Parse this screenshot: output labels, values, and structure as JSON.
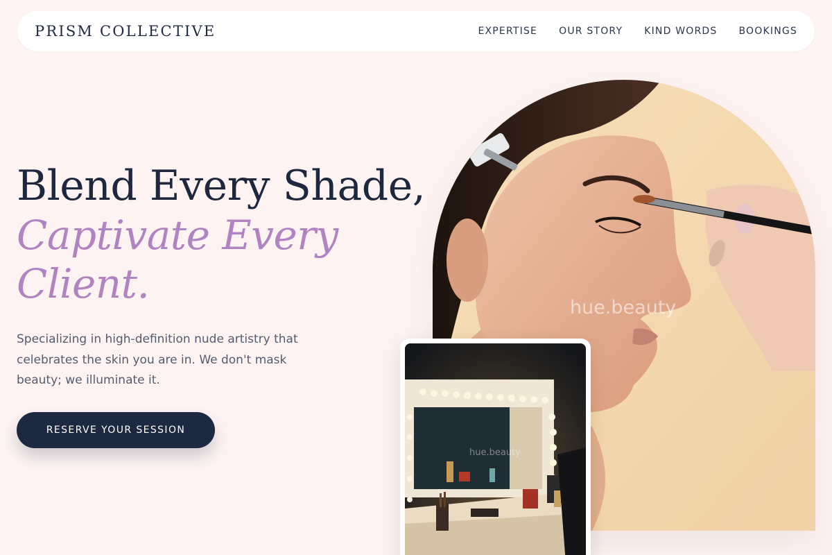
{
  "brand": "PRISM COLLECTIVE",
  "nav": {
    "links": [
      "EXPERTISE",
      "OUR STORY",
      "KIND WORDS",
      "BOOKINGS"
    ]
  },
  "hero": {
    "heading_line_1": "Blend Every Shade,",
    "heading_line_2": "Captivate Every Client.",
    "description": "Specializing in high-definition nude artistry that celebrates the skin you are in. We don't mask beauty; we illuminate it.",
    "cta_label": "RESERVE YOUR SESSION"
  },
  "images": {
    "main_watermark": "hue.beauty",
    "vanity_watermark": "hue.beauty"
  },
  "colors": {
    "background": "#fdf3f2",
    "navy": "#1d2841",
    "lavender": "#b084c0",
    "body_text": "#545c6d"
  }
}
